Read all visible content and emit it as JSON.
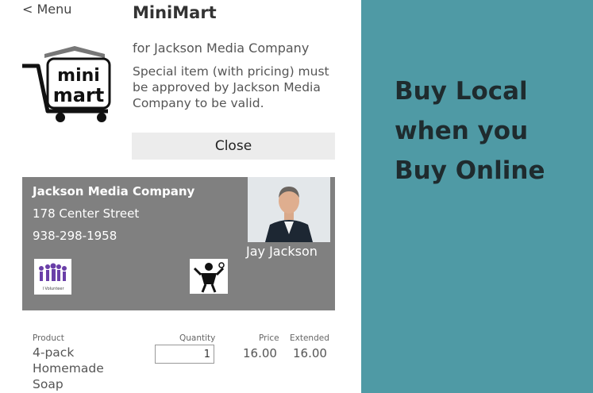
{
  "nav": {
    "back_label": "< Menu"
  },
  "app": {
    "title": "MiniMart"
  },
  "logo": {
    "text_top": "mini",
    "text_bottom": "mart"
  },
  "info": {
    "subtitle": "for Jackson Media Company",
    "notice": "Special item (with pricing) must be approved by Jackson Media Company to be valid."
  },
  "close_button": {
    "label": "Close"
  },
  "business": {
    "name": "Jackson Media Company",
    "address": "178 Center Street",
    "phone": "938-298-1958",
    "contact_name": "Jay Jackson",
    "badge1_caption": "I Volunteer"
  },
  "order": {
    "headers": {
      "product": "Product",
      "quantity": "Quantity",
      "price": "Price",
      "extended": "Extended"
    },
    "item": {
      "product": "4-pack Homemade Soap",
      "quantity": "1",
      "price": "16.00",
      "extended": "16.00"
    }
  },
  "promo": {
    "lines": [
      "Buy Local",
      "when you",
      "Buy Online"
    ]
  },
  "colors": {
    "panel": "#4f9aa5",
    "card": "#808080",
    "close_button": "#ececec",
    "tagline_text": "#1f2b2e"
  },
  "icons": {
    "logo": "minimart-cart-logo",
    "photo": "person-photo",
    "badge1": "volunteers-icon",
    "badge2": "community-icon"
  }
}
